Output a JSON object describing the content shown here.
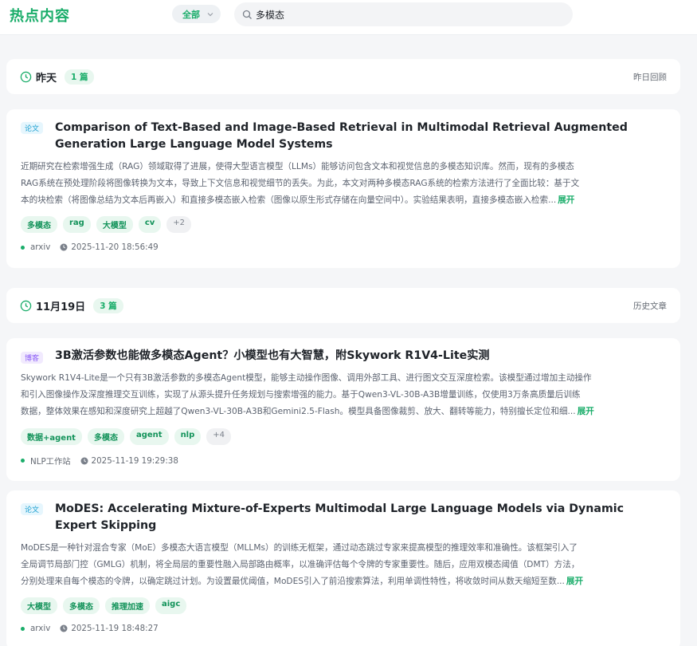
{
  "header": {
    "brand": "热点内容",
    "filter_value": "全部",
    "search_value": "多模态"
  },
  "groups": [
    {
      "title": "昨天",
      "count": "1 篇",
      "link": "昨日回顾"
    },
    {
      "title": "11月19日",
      "count": "3 篇",
      "link": "历史文章"
    }
  ],
  "cards": [
    {
      "type": "论文",
      "title": "Comparison of Text-Based and Image-Based Retrieval in Multimodal Retrieval Augmented Generation Large Language Model Systems",
      "summary_lines": [
        "近期研究在检索增强生成（RAG）领域取得了进展，使得大型语言模型（LLMs）能够访问包含文本和视觉信息的多模态知识库。然而，现有的多模态",
        "RAG系统在预处理阶段将图像转换为文本，导致上下文信息和视觉细节的丢失。为此，本文对两种多模态RAG系统的检索方法进行了全面比较：基于文",
        "本的块检索（将图像总结为文本后再嵌入）和直接多模态嵌入检索（图像以原生形式存储在向量空间中）。实验结果表明，直接多模态嵌入检索..."
      ],
      "expand_label": "展开",
      "tags": [
        "多模态",
        "rag",
        "大模型",
        "cv"
      ],
      "more_tags": "+2",
      "source": "arxiv",
      "time": "2025-11-20 18:56:49"
    },
    {
      "type": "博客",
      "title": "3B激活参数也能做多模态Agent？小模型也有大智慧，附Skywork R1V4-Lite实测",
      "summary_lines": [
        "Skywork R1V4-Lite是一个只有3B激活参数的多模态Agent模型，能够主动操作图像、调用外部工具、进行图文交互深度检索。该模型通过增加主动操作",
        "和引入图像操作及深度推理交互训练，实现了从源头提升任务规划与搜索增强的能力。基于Qwen3-VL-30B-A3B增量训练，仅使用3万条高质量后训练",
        "数据，整体效果在感知和深度研究上超越了Qwen3-VL-30B-A3B和Gemini2.5-Flash。模型具备图像裁剪、放大、翻转等能力，特别擅长定位和细..."
      ],
      "expand_label": "展开",
      "tags": [
        "数据+agent",
        "多模态",
        "agent",
        "nlp"
      ],
      "more_tags": "+4",
      "source": "NLP工作站",
      "time": "2025-11-19 19:29:38"
    },
    {
      "type": "论文",
      "title": "MoDES: Accelerating Mixture-of-Experts Multimodal Large Language Models via Dynamic Expert Skipping",
      "summary_lines": [
        "MoDES是一种针对混合专家（MoE）多模态大语言模型（MLLMs）的训练无框架，通过动态跳过专家来提高模型的推理效率和准确性。该框架引入了",
        "全局调节局部门控（GMLG）机制，将全局层的重要性融入局部路由概率，以准确评估每个令牌的专家重要性。随后，应用双模态阈值（DMT）方法，",
        "分别处理来自每个模态的令牌，以确定跳过计划。为设置最优阈值，MoDES引入了前沿搜索算法，利用单调性特性，将收敛时间从数天缩短至数..."
      ],
      "expand_label": "展开",
      "tags": [
        "大模型",
        "多模态",
        "推理加速",
        "aigc"
      ],
      "more_tags": "",
      "source": "arxiv",
      "time": "2025-11-19 18:48:27"
    }
  ],
  "colors": {
    "accent": "#1aad6a",
    "paper_badge": "#1a9fd0",
    "blog_badge": "#8b5cf6",
    "background": "#f5f6f8"
  },
  "icons": {
    "filter": "chevron-down-icon",
    "search": "search-icon",
    "group": "clock-icon",
    "meta_time": "clock-icon"
  }
}
